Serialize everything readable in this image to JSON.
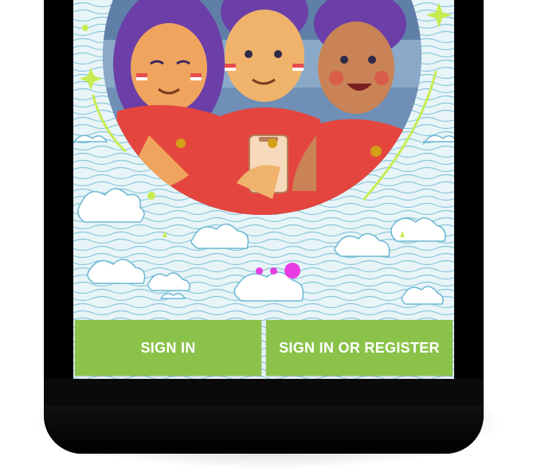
{
  "colors": {
    "accent": "#8bc34a",
    "button_text": "#ffffff",
    "indicator_active": "#e93de3",
    "pattern_line": "#5fb3cf",
    "background": "#e6f2f5"
  },
  "onboarding": {
    "illustration": "three-football-fans-illustration",
    "page_indicator": {
      "count": 3,
      "active_index": 2
    }
  },
  "actions": {
    "sign_in_label": "SIGN IN",
    "register_label": "SIGN IN OR REGISTER"
  }
}
